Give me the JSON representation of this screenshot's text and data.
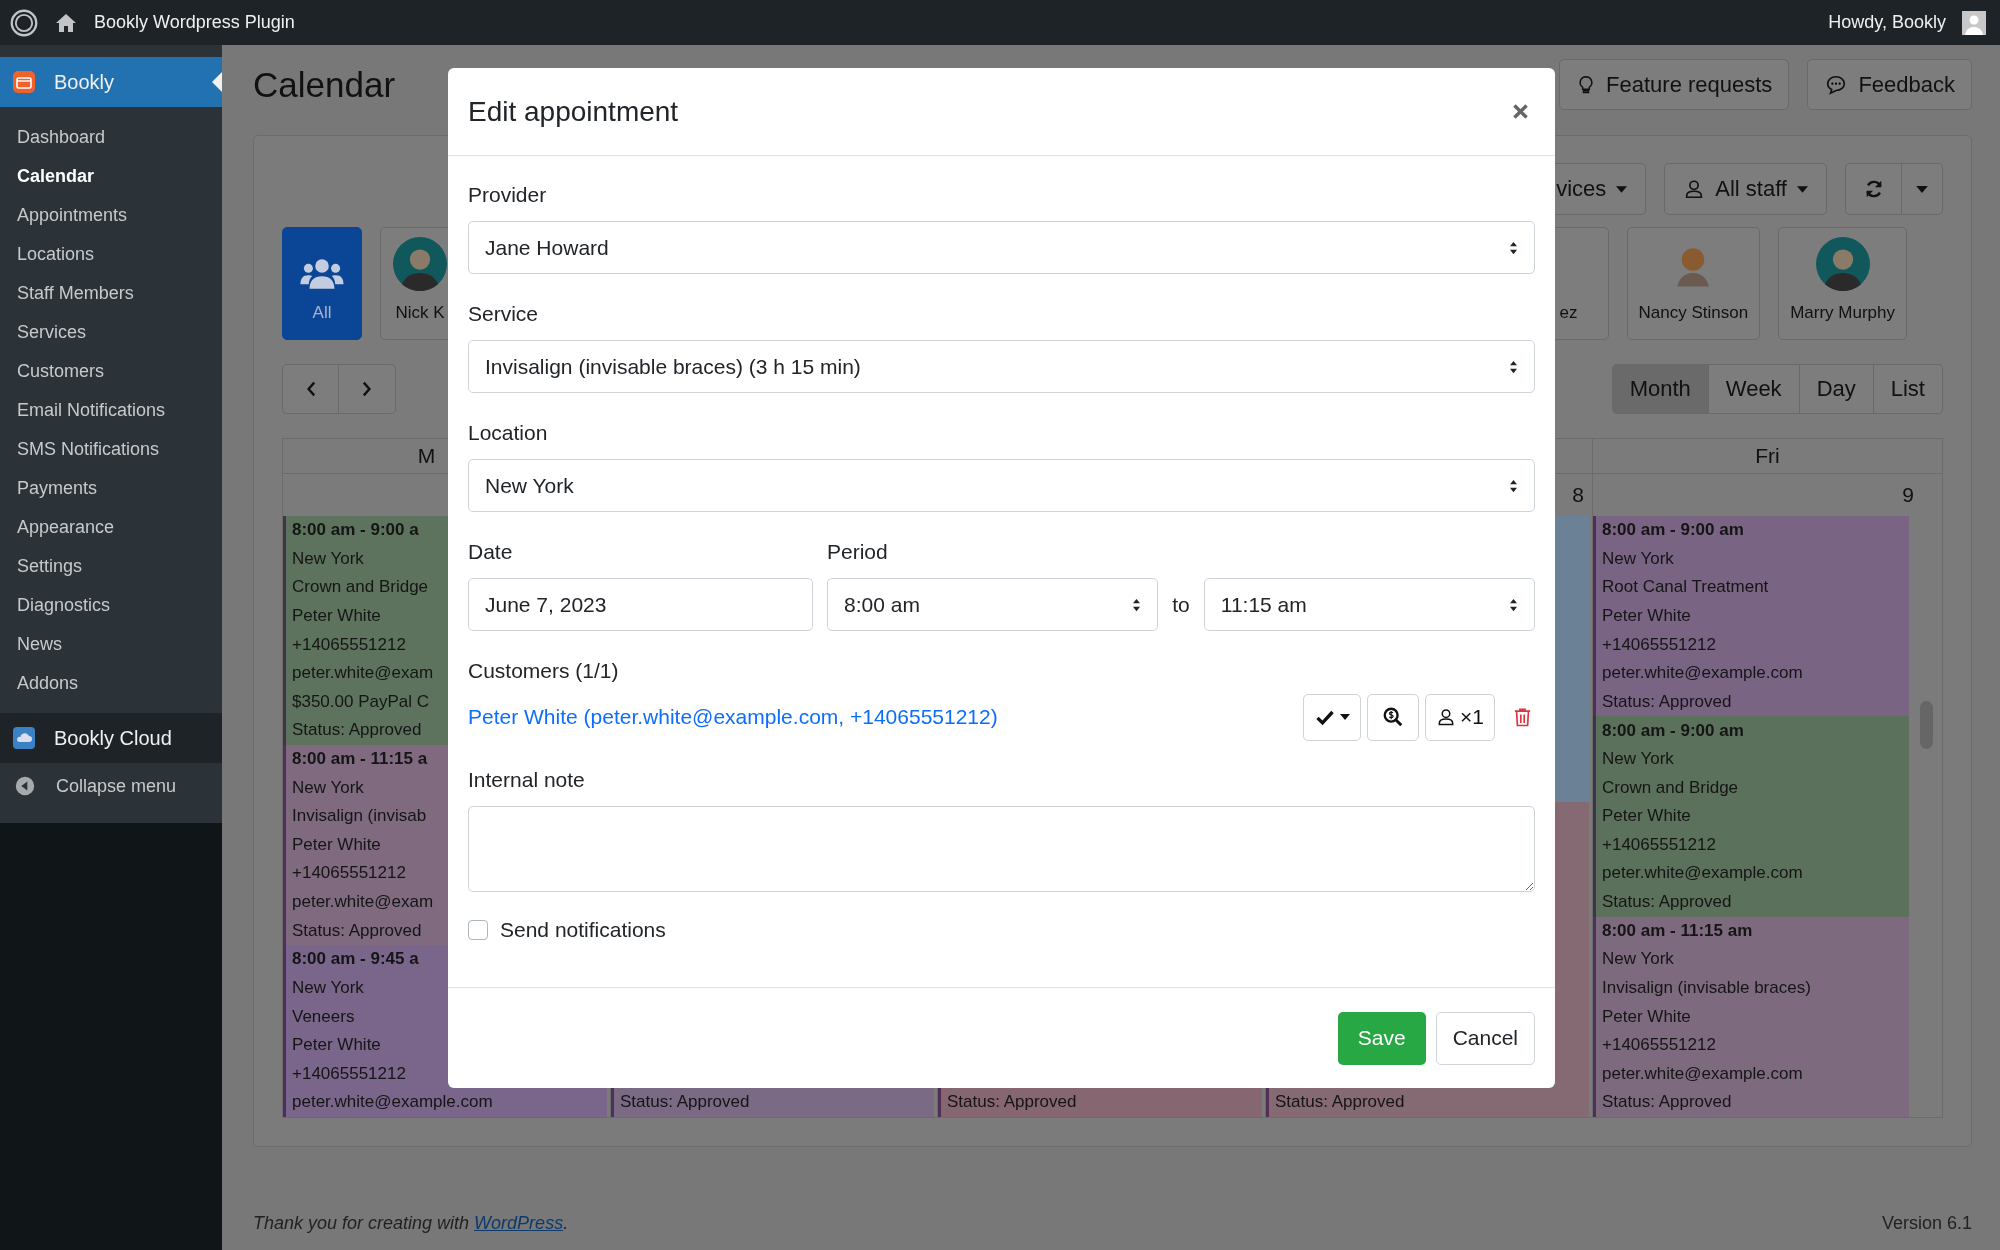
{
  "admin_bar": {
    "site_title": "Bookly Wordpress Plugin",
    "greeting": "Howdy, Bookly"
  },
  "sidebar": {
    "plugin": {
      "label": "Bookly",
      "selected": true
    },
    "items": [
      {
        "label": "Dashboard",
        "selected": false
      },
      {
        "label": "Calendar",
        "selected": true
      },
      {
        "label": "Appointments",
        "selected": false
      },
      {
        "label": "Locations",
        "selected": false
      },
      {
        "label": "Staff Members",
        "selected": false
      },
      {
        "label": "Services",
        "selected": false
      },
      {
        "label": "Customers",
        "selected": false
      },
      {
        "label": "Email Notifications",
        "selected": false
      },
      {
        "label": "SMS Notifications",
        "selected": false
      },
      {
        "label": "Payments",
        "selected": false
      },
      {
        "label": "Appearance",
        "selected": false
      },
      {
        "label": "Settings",
        "selected": false
      },
      {
        "label": "Diagnostics",
        "selected": false
      },
      {
        "label": "News",
        "selected": false
      },
      {
        "label": "Addons",
        "selected": false
      }
    ],
    "cloud": "Bookly Cloud",
    "collapse": "Collapse menu"
  },
  "page": {
    "title": "Calendar",
    "header_buttons": [
      {
        "label": "Feature requests",
        "kind": "bulb"
      },
      {
        "label": "Feedback",
        "kind": "chat"
      }
    ]
  },
  "filters": {
    "services": "vices",
    "staff": "All staff"
  },
  "staff": [
    {
      "name": "All",
      "selected": true,
      "kind": "group"
    },
    {
      "name": "Nick K",
      "selected": false,
      "kind": "ring"
    },
    {
      "name": "ez",
      "selected": false,
      "kind": "hidden"
    },
    {
      "name": "Nancy Stinson",
      "selected": false,
      "kind": "plain"
    },
    {
      "name": "Marry Murphy",
      "selected": false,
      "kind": "ring"
    }
  ],
  "views": [
    {
      "label": "Month",
      "selected": true
    },
    {
      "label": "Week",
      "selected": false
    },
    {
      "label": "Day",
      "selected": false
    },
    {
      "label": "List",
      "selected": false
    }
  ],
  "calendar": {
    "columns": [
      {
        "day": "M",
        "events": [
          {
            "color": "#5d735d",
            "lines": [
              "8:00 am - 9:00 a",
              "New York",
              "Crown and Bridge",
              "Peter White",
              "+14065551212",
              "peter.white@exam",
              "$350.00 PayPal C",
              "Status: Approved"
            ]
          },
          {
            "color": "#7f6a80",
            "lines": [
              "8:00 am - 11:15 a",
              "New York",
              "Invisalign (invisab",
              "Peter White",
              "+14065551212",
              "peter.white@exam",
              "Status: Approved"
            ]
          },
          {
            "color": "#79668a",
            "lines": [
              "8:00 am - 9:45 a",
              "New York",
              "Veneers",
              "Peter White",
              "+14065551212",
              "peter.white@example.com"
            ]
          }
        ]
      },
      {
        "events": [
          {
            "color": "#7b6a84",
            "lines": [
              "Status: Approved"
            ]
          }
        ]
      },
      {
        "events": [
          {
            "color": "#866670",
            "lines": [
              "Status: Approved"
            ]
          }
        ]
      },
      {
        "date": "8",
        "events": [
          {
            "color": "#6b8296"
          },
          {
            "color": "#856a74",
            "lines": [
              "Status: Approved"
            ]
          }
        ]
      },
      {
        "day": "Fri",
        "date": "9",
        "events": [
          {
            "color": "#7a6484",
            "lines": [
              "8:00 am - 9:00 am",
              "New York",
              "Root Canal Treatment",
              "Peter White",
              "+14065551212",
              "peter.white@example.com",
              "Status: Approved"
            ]
          },
          {
            "color": "#5b715b",
            "lines": [
              "8:00 am - 9:00 am",
              "New York",
              "Crown and Bridge",
              "Peter White",
              "+14065551212",
              "peter.white@example.com",
              "Status: Approved"
            ]
          },
          {
            "color": "#7e6a7e",
            "lines": [
              "8:00 am - 11:15 am",
              "New York",
              "Invisalign (invisable braces)",
              "Peter White",
              "+14065551212",
              "peter.white@example.com",
              "Status: Approved"
            ]
          }
        ]
      }
    ]
  },
  "modal": {
    "title": "Edit appointment",
    "provider": {
      "label": "Provider",
      "value": "Jane Howard"
    },
    "service": {
      "label": "Service",
      "value": "Invisalign (invisable braces) (3 h 15 min)"
    },
    "location": {
      "label": "Location",
      "value": "New York"
    },
    "date": {
      "label": "Date",
      "value": "June 7, 2023"
    },
    "period": {
      "label": "Period",
      "start": "8:00 am",
      "separator": "to",
      "end": "11:15 am"
    },
    "customers": {
      "label": "Customers (1/1)",
      "items": [
        {
          "name": "Peter White (peter.white@example.com, +14065551212)",
          "count": "×1"
        }
      ]
    },
    "note": {
      "label": "Internal note"
    },
    "notify": {
      "label": "Send notifications",
      "checked": false
    },
    "buttons": {
      "save": "Save",
      "cancel": "Cancel"
    }
  },
  "footer": {
    "text_before": "Thank you for creating with ",
    "link": "WordPress",
    "text_after": ".",
    "version": "Version 6.1"
  }
}
